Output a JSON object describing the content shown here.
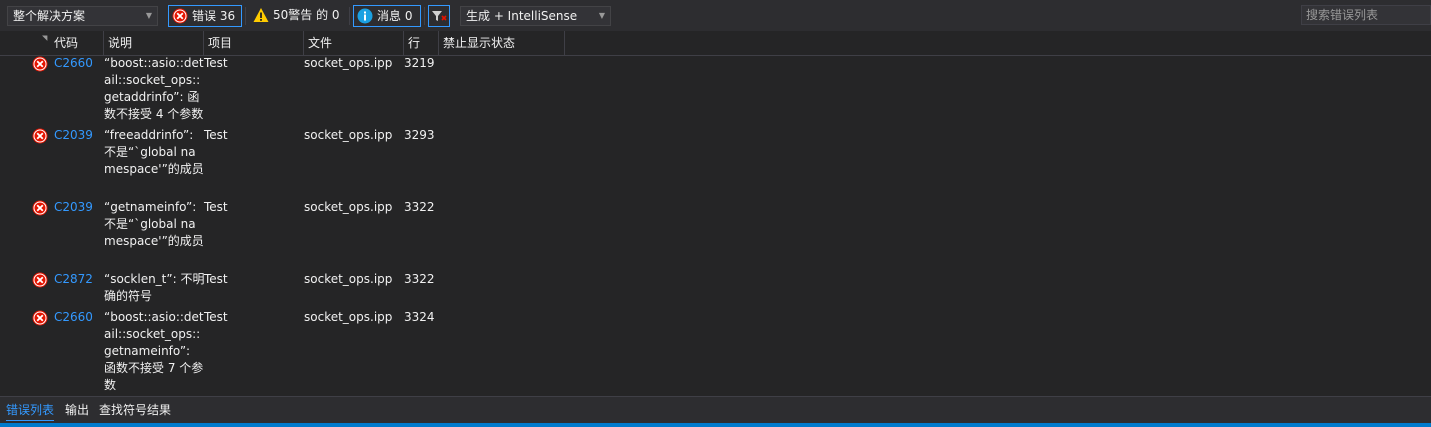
{
  "toolbar": {
    "scope": "整个解决方案",
    "errors_label": "错误 36",
    "warnings_label": "50警告 的 0",
    "messages_label": "消息 0",
    "build_filter": "生成 + IntelliSense",
    "search_placeholder": "搜索错误列表"
  },
  "columns": {
    "code": "代码",
    "description": "说明",
    "project": "项目",
    "file": "文件",
    "line": "行",
    "suppression": "禁止显示状态"
  },
  "rows": [
    {
      "code": "C2660",
      "description": "“boost::asio::detail::socket_ops::getaddrinfo”: 函数不接受 4 个参数",
      "project": "Test",
      "file": "socket_ops.ipp",
      "line": "3219"
    },
    {
      "code": "C2039",
      "description": "“freeaddrinfo”: 不是“`global namespace'”的成员",
      "project": "Test",
      "file": "socket_ops.ipp",
      "line": "3293"
    },
    {
      "code": "C2039",
      "description": "“getnameinfo”: 不是“`global namespace'”的成员",
      "project": "Test",
      "file": "socket_ops.ipp",
      "line": "3322"
    },
    {
      "code": "C2872",
      "description": "“socklen_t”: 不明确的符号",
      "project": "Test",
      "file": "socket_ops.ipp",
      "line": "3322"
    },
    {
      "code": "C2660",
      "description": "“boost::asio::detail::socket_ops::getnameinfo”: 函数不接受 7 个参数",
      "project": "Test",
      "file": "socket_ops.ipp",
      "line": "3324"
    }
  ],
  "footer_tabs": [
    "错误列表",
    "输出",
    "查找符号结果"
  ],
  "colors": {
    "accent": "#3399ff",
    "error": "#e51400",
    "warning": "#ffcc00",
    "info": "#1ba1e2"
  }
}
